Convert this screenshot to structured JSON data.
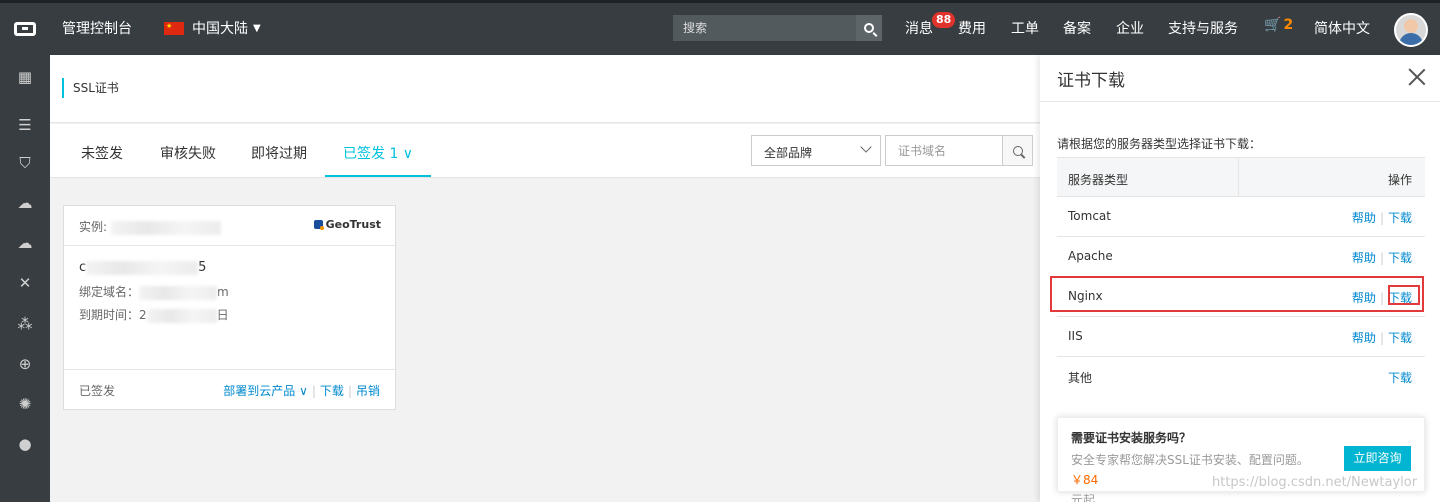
{
  "topbar": {
    "console": "管理控制台",
    "region": "中国大陆",
    "search_placeholder": "搜索",
    "messages": "消息",
    "messages_badge": "88",
    "fees": "费用",
    "tickets": "工单",
    "record": "备案",
    "enterprise": "企业",
    "support": "支持与服务",
    "cart_count": "2",
    "language": "简体中文"
  },
  "page": {
    "title": "SSL证书"
  },
  "tabs": [
    {
      "label": "未签发"
    },
    {
      "label": "审核失败"
    },
    {
      "label": "即将过期"
    },
    {
      "label": "已签发 1"
    }
  ],
  "filters": {
    "brand": "全部品牌",
    "domain_placeholder": "证书域名"
  },
  "card": {
    "instance_label": "实例:",
    "brand": "GeoTrust",
    "id_start": "c",
    "id_end": "5",
    "domain_label": "绑定域名：",
    "domain_end": "m",
    "expire_label": "到期时间：2",
    "expire_end": "日",
    "status": "已签发",
    "deploy": "部署到云产品",
    "download": "下载",
    "revoke": "吊销"
  },
  "drawer": {
    "title": "证书下载",
    "hint": "请根据您的服务器类型选择证书下载：",
    "col_server": "服务器类型",
    "col_action": "操作",
    "help": "帮助",
    "download": "下载",
    "rows": [
      {
        "name": "Tomcat"
      },
      {
        "name": "Apache"
      },
      {
        "name": "Nginx"
      },
      {
        "name": "IIS"
      },
      {
        "name": "其他"
      }
    ],
    "promo_title": "需要证书安装服务吗？",
    "promo_desc": "安全专家帮您解决SSL证书安装、配置问题。",
    "promo_price": "￥84",
    "promo_unit": "元起",
    "promo_button": "立即咨询"
  },
  "watermark": "https://blog.csdn.net/Newtaylor",
  "colors": {
    "topbar": "#373d41",
    "accent": "#00c1de",
    "link": "#0089cf",
    "highlight": "#e23a3a",
    "price": "#ff6a00"
  }
}
